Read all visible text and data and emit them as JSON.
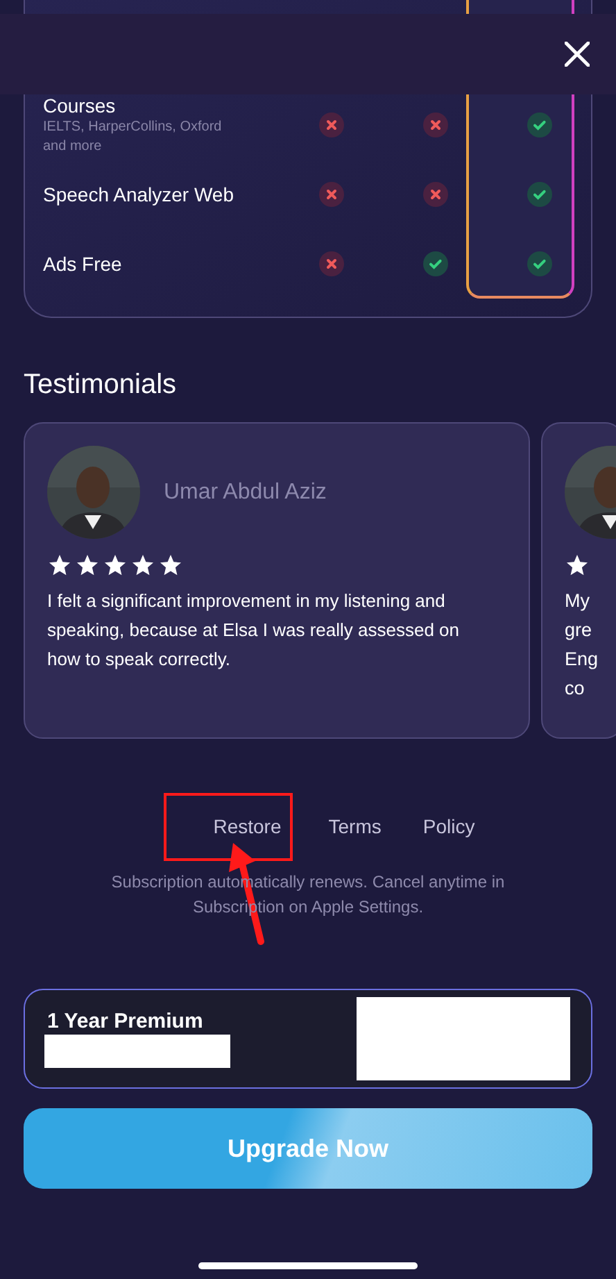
{
  "features": [
    {
      "name": "Courses",
      "note": "IELTS, HarperCollins, Oxford and more",
      "tiers": [
        {
          "included": false
        },
        {
          "included": false
        },
        {
          "included": true
        }
      ]
    },
    {
      "name": "Speech Analyzer Web",
      "tiers": [
        {
          "included": false
        },
        {
          "included": false
        },
        {
          "included": true
        }
      ]
    },
    {
      "name": "Ads Free",
      "tiers": [
        {
          "included": false
        },
        {
          "included": true
        },
        {
          "included": true
        }
      ]
    }
  ],
  "testimonials_title": "Testimonials",
  "testimonials": [
    {
      "name": "Umar Abdul Aziz",
      "stars": 5,
      "lines": [
        "I felt a significant improvement in my listening and speaking, because at Elsa I was really assessed on how to speak correctly."
      ]
    },
    {
      "lines": [
        "My",
        "gre",
        "Eng",
        "co"
      ]
    }
  ],
  "links": [
    {
      "label": "Restore",
      "highlighted": true
    },
    {
      "label": "Terms",
      "highlighted": false
    },
    {
      "label": "Policy",
      "highlighted": false
    }
  ],
  "disclaimer": "Subscription automatically renews. Cancel anytime in Subscription on Apple Settings.",
  "plan": {
    "title": "1 Year Premium"
  },
  "upgrade_button": "Upgrade Now"
}
